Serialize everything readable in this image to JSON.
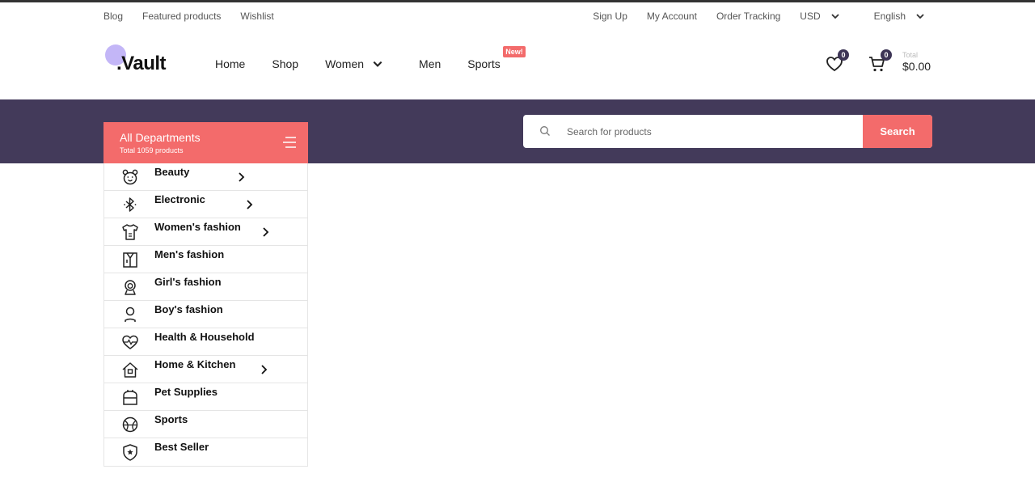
{
  "topbar": {
    "left_links": [
      "Blog",
      "Featured products",
      "Wishlist"
    ],
    "right_links": [
      "Sign Up",
      "My Account",
      "Order Tracking"
    ],
    "currency": "USD",
    "language": "English"
  },
  "header": {
    "logo_text": ".Vault",
    "nav": {
      "home": "Home",
      "shop": "Shop",
      "women": "Women",
      "men": "Men",
      "sports": "Sports",
      "new_badge": "New!"
    },
    "wishlist_count": "0",
    "cart_count": "0",
    "cart_label": "Total",
    "cart_total": "$0.00"
  },
  "departments": {
    "title": "All Departments",
    "subtitle": "Total 1059 products",
    "items": [
      {
        "label": "Beauty",
        "icon": "bear-icon",
        "arrow": true
      },
      {
        "label": "Electronic",
        "icon": "bluetooth-icon",
        "arrow": true
      },
      {
        "label": "Women's fashion",
        "icon": "shirt-icon",
        "arrow": true
      },
      {
        "label": "Men's fashion",
        "icon": "jacket-icon",
        "arrow": false
      },
      {
        "label": "Girl's fashion",
        "icon": "girl-icon",
        "arrow": false
      },
      {
        "label": "Boy's fashion",
        "icon": "boy-icon",
        "arrow": false
      },
      {
        "label": "Health & Household",
        "icon": "heartbeat-icon",
        "arrow": false
      },
      {
        "label": "Home & Kitchen",
        "icon": "house-icon",
        "arrow": true
      },
      {
        "label": "Pet Supplies",
        "icon": "pet-icon",
        "arrow": false
      },
      {
        "label": "Sports",
        "icon": "basketball-icon",
        "arrow": false
      },
      {
        "label": "Best Seller",
        "icon": "shield-star-icon",
        "arrow": false
      }
    ]
  },
  "search": {
    "placeholder": "Search for products",
    "button_label": "Search"
  },
  "colors": {
    "accent": "#f36b6b",
    "band": "#433a5a",
    "logo_dot": "#c3b6f7"
  }
}
